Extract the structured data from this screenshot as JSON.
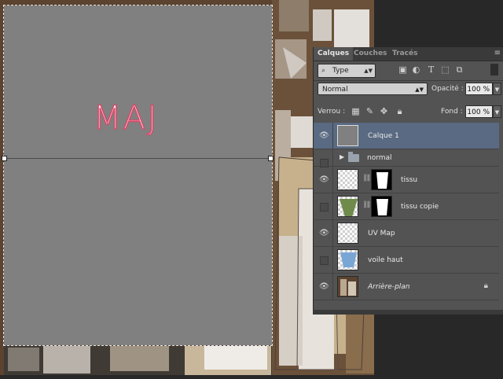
{
  "canvas": {
    "selection_text": "MAJ"
  },
  "layers_panel": {
    "tabs": [
      {
        "label": "Calques",
        "active": true
      },
      {
        "label": "Couches",
        "active": false
      },
      {
        "label": "Tracés",
        "active": false
      }
    ],
    "filter": {
      "label": "Type",
      "icon": "search-icon"
    },
    "filter_icons": [
      "image-filter-icon",
      "adjustment-filter-icon",
      "text-filter-icon",
      "shape-filter-icon",
      "smart-object-filter-icon"
    ],
    "blend_mode": "Normal",
    "opacity_label": "Opacité :",
    "opacity_value": "100 %",
    "lock_label": "Verrou :",
    "lock_icons": [
      "lock-transparent-icon",
      "lock-paint-icon",
      "lock-move-icon",
      "lock-all-icon"
    ],
    "fill_label": "Fond :",
    "fill_value": "100 %",
    "layers": [
      {
        "name": "Calque 1",
        "visible": true,
        "selected": true,
        "type": "layer",
        "thumb": "gray"
      },
      {
        "name": "normal",
        "visible": false,
        "selected": false,
        "type": "group"
      },
      {
        "name": "tissu",
        "visible": true,
        "selected": false,
        "type": "masked",
        "thumb": "checker"
      },
      {
        "name": "tissu copie",
        "visible": false,
        "selected": false,
        "type": "masked",
        "thumb": "green"
      },
      {
        "name": "UV Map",
        "visible": true,
        "selected": false,
        "type": "layer",
        "thumb": "checker"
      },
      {
        "name": "voile haut",
        "visible": false,
        "selected": false,
        "type": "layer",
        "thumb": "blue"
      },
      {
        "name": "Arrière-plan",
        "visible": true,
        "selected": false,
        "type": "background",
        "thumb": "photo",
        "locked": true
      }
    ]
  },
  "colors": {
    "selection_fill": "#808080",
    "panel_bg": "#535353",
    "selected_layer": "#596a82",
    "text_stroke": "#d64a6a"
  }
}
